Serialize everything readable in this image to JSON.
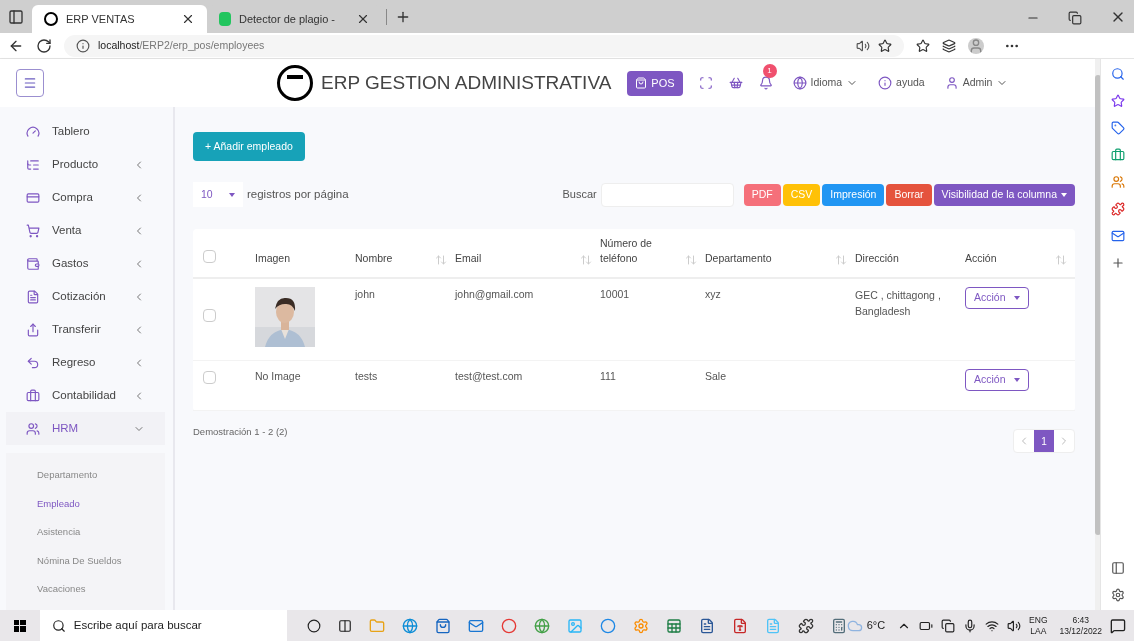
{
  "browser": {
    "tabs": [
      {
        "title": "ERP VENTAS",
        "selected": true
      },
      {
        "title": "Detector de plagio -",
        "selected": false
      }
    ],
    "url_host": "localhost",
    "url_path": "/ERP2/erp_pos/employees"
  },
  "header": {
    "brand": "ERP GESTION ADMINISTRATIVA",
    "pos_button": "POS",
    "notification_count": "1",
    "language": "Idioma",
    "help": "ayuda",
    "user": "Admin"
  },
  "sidebar": {
    "items": [
      {
        "label": "Tablero",
        "kind": "gauge",
        "has_submenu": false,
        "expanded": false
      },
      {
        "label": "Producto",
        "kind": "list",
        "has_submenu": true,
        "expanded": false
      },
      {
        "label": "Compra",
        "kind": "card",
        "has_submenu": true,
        "expanded": false
      },
      {
        "label": "Venta",
        "kind": "cart",
        "has_submenu": true,
        "expanded": false
      },
      {
        "label": "Gastos",
        "kind": "wallet",
        "has_submenu": true,
        "expanded": false
      },
      {
        "label": "Cotización",
        "kind": "document",
        "has_submenu": true,
        "expanded": false
      },
      {
        "label": "Transferir",
        "kind": "share",
        "has_submenu": true,
        "expanded": false
      },
      {
        "label": "Regreso",
        "kind": "undo",
        "has_submenu": true,
        "expanded": false
      },
      {
        "label": "Contabilidad",
        "kind": "briefcase",
        "has_submenu": true,
        "expanded": false
      },
      {
        "label": "HRM",
        "kind": "users",
        "has_submenu": true,
        "expanded": true,
        "children": [
          {
            "label": "Departamento",
            "selected": false
          },
          {
            "label": "Empleado",
            "selected": true
          },
          {
            "label": "Asistencia",
            "selected": false
          },
          {
            "label": "Nómina De Sueldos",
            "selected": false
          },
          {
            "label": "Vacaciones",
            "selected": false
          }
        ]
      }
    ]
  },
  "content": {
    "add_button": "+ Añadir empleado",
    "page_size": "10",
    "page_size_label": "registros por página",
    "search_label": "Buscar",
    "export_buttons": [
      {
        "label": "PDF",
        "color": "#f5707a"
      },
      {
        "label": "CSV",
        "color": "#ffc107"
      },
      {
        "label": "Impresión",
        "color": "#2196f3"
      },
      {
        "label": "Borrar",
        "color": "#e5533d"
      },
      {
        "label": "Visibilidad de la columna",
        "color": "#7e57c2"
      }
    ],
    "table": {
      "select_all_checked": false,
      "columns": [
        {
          "label": "Imagen",
          "sortable": false
        },
        {
          "label": "Nombre",
          "sortable": true
        },
        {
          "label": "Email",
          "sortable": true
        },
        {
          "label": "Número de teléfono",
          "sortable": true
        },
        {
          "label": "Departamento",
          "sortable": true
        },
        {
          "label": "Dirección",
          "sortable": false
        },
        {
          "label": "Acción",
          "sortable": true
        }
      ],
      "rows": [
        {
          "checked": false,
          "name": "john",
          "email": "john@gmail.com",
          "phone": "10001",
          "department": "xyz",
          "address": "GEC , chittagong , Bangladesh",
          "action": "Acción"
        },
        {
          "checked": false,
          "image": {
            "kind": "text",
            "text": "No Image"
          },
          "name": "tests",
          "email": "test@test.com",
          "phone": "111",
          "department": "Sale",
          "action": "Acción"
        }
      ]
    },
    "summary": "Demostración 1 - 2 (2)",
    "pagination": [
      {
        "label": "1",
        "selected": true
      }
    ]
  },
  "taskbar": {
    "search_placeholder": "Escribe aquí para buscar",
    "weather": "6°C",
    "language": "ENG",
    "layout": "LAA",
    "time": "6:43",
    "date": "13/12/2022"
  }
}
